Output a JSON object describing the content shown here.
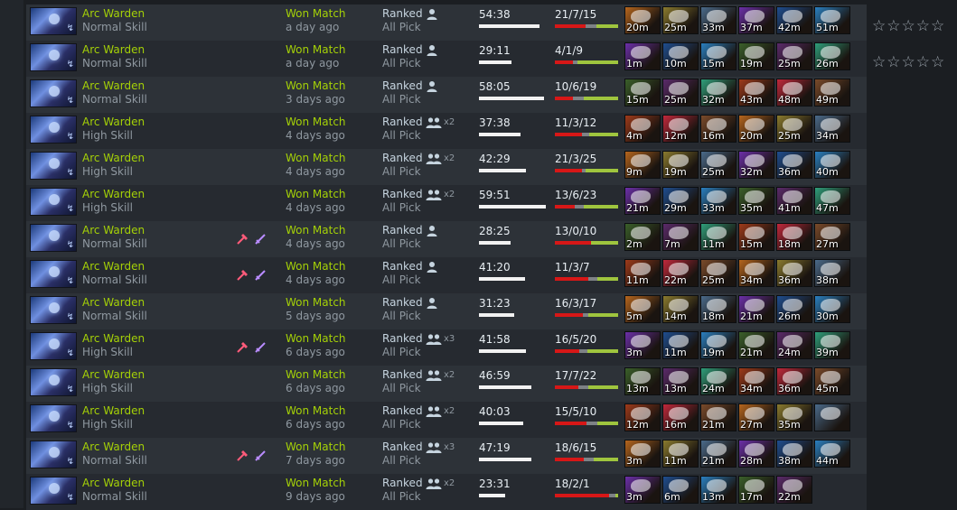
{
  "colors": {
    "win": "#a4d007",
    "muted": "#8f98a0",
    "kills": "#d71717",
    "deaths": "#7e8286",
    "assists": "#9fc53e"
  },
  "item_palette": [
    "#b5651d",
    "#2a7fbf",
    "#c0283b",
    "#6b2fa8",
    "#2f9e7a",
    "#8a7a2e",
    "#3a5f2a",
    "#7a4a2a",
    "#1e4d8f",
    "#9e3a1a",
    "#4a6a8a",
    "#5a2a6a"
  ],
  "matches": [
    {
      "hero": "Arc Warden",
      "skill": "Normal Skill",
      "party_icons": false,
      "result": "Won Match",
      "ago": "a day ago",
      "lobby": "Ranked",
      "party": "solo",
      "party_count": "",
      "mode": "All Pick",
      "duration": "54:38",
      "dur_min": 54.6,
      "kda": "21/7/15",
      "k": 21,
      "d": 7,
      "a": 15,
      "items": [
        "20m",
        "25m",
        "33m",
        "37m",
        "42m",
        "51m"
      ],
      "rating": {
        "stars": 5,
        "filled": 0
      }
    },
    {
      "hero": "Arc Warden",
      "skill": "Normal Skill",
      "party_icons": false,
      "result": "Won Match",
      "ago": "a day ago",
      "lobby": "Ranked",
      "party": "solo",
      "party_count": "",
      "mode": "All Pick",
      "duration": "29:11",
      "dur_min": 29.2,
      "kda": "4/1/9",
      "k": 4,
      "d": 1,
      "a": 9,
      "items": [
        "1m",
        "10m",
        "15m",
        "19m",
        "25m",
        "26m"
      ],
      "rating": {
        "stars": 5,
        "filled": 0
      }
    },
    {
      "hero": "Arc Warden",
      "skill": "Normal Skill",
      "party_icons": false,
      "result": "Won Match",
      "ago": "3 days ago",
      "lobby": "Ranked",
      "party": "solo",
      "party_count": "",
      "mode": "All Pick",
      "duration": "58:05",
      "dur_min": 58.1,
      "kda": "10/6/19",
      "k": 10,
      "d": 6,
      "a": 19,
      "items": [
        "15m",
        "25m",
        "32m",
        "43m",
        "48m",
        "49m"
      ]
    },
    {
      "hero": "Arc Warden",
      "skill": "High Skill",
      "party_icons": false,
      "result": "Won Match",
      "ago": "4 days ago",
      "lobby": "Ranked",
      "party": "group",
      "party_count": "x2",
      "mode": "All Pick",
      "duration": "37:38",
      "dur_min": 37.6,
      "kda": "11/3/12",
      "k": 11,
      "d": 3,
      "a": 12,
      "items": [
        "4m",
        "12m",
        "16m",
        "20m",
        "25m",
        "34m"
      ]
    },
    {
      "hero": "Arc Warden",
      "skill": "High Skill",
      "party_icons": false,
      "result": "Won Match",
      "ago": "4 days ago",
      "lobby": "Ranked",
      "party": "group",
      "party_count": "x2",
      "mode": "All Pick",
      "duration": "42:29",
      "dur_min": 42.5,
      "kda": "21/3/25",
      "k": 21,
      "d": 3,
      "a": 25,
      "items": [
        "9m",
        "19m",
        "25m",
        "32m",
        "36m",
        "40m"
      ]
    },
    {
      "hero": "Arc Warden",
      "skill": "High Skill",
      "party_icons": false,
      "result": "Won Match",
      "ago": "4 days ago",
      "lobby": "Ranked",
      "party": "group",
      "party_count": "x2",
      "mode": "All Pick",
      "duration": "59:51",
      "dur_min": 59.9,
      "kda": "13/6/23",
      "k": 13,
      "d": 6,
      "a": 23,
      "items": [
        "21m",
        "29m",
        "33m",
        "35m",
        "41m",
        "47m"
      ]
    },
    {
      "hero": "Arc Warden",
      "skill": "Normal Skill",
      "party_icons": true,
      "result": "Won Match",
      "ago": "4 days ago",
      "lobby": "Ranked",
      "party": "solo",
      "party_count": "",
      "mode": "All Pick",
      "duration": "28:25",
      "dur_min": 28.4,
      "kda": "13/0/10",
      "k": 13,
      "d": 0,
      "a": 10,
      "items": [
        "2m",
        "7m",
        "11m",
        "15m",
        "18m",
        "27m"
      ]
    },
    {
      "hero": "Arc Warden",
      "skill": "Normal Skill",
      "party_icons": true,
      "result": "Won Match",
      "ago": "4 days ago",
      "lobby": "Ranked",
      "party": "solo",
      "party_count": "",
      "mode": "All Pick",
      "duration": "41:20",
      "dur_min": 41.3,
      "kda": "11/3/7",
      "k": 11,
      "d": 3,
      "a": 7,
      "items": [
        "11m",
        "22m",
        "25m",
        "34m",
        "36m",
        "38m"
      ]
    },
    {
      "hero": "Arc Warden",
      "skill": "Normal Skill",
      "party_icons": false,
      "result": "Won Match",
      "ago": "5 days ago",
      "lobby": "Ranked",
      "party": "solo",
      "party_count": "",
      "mode": "All Pick",
      "duration": "31:23",
      "dur_min": 31.4,
      "kda": "16/3/17",
      "k": 16,
      "d": 3,
      "a": 17,
      "items": [
        "5m",
        "14m",
        "18m",
        "21m",
        "26m",
        "30m"
      ]
    },
    {
      "hero": "Arc Warden",
      "skill": "High Skill",
      "party_icons": true,
      "result": "Won Match",
      "ago": "6 days ago",
      "lobby": "Ranked",
      "party": "group",
      "party_count": "x3",
      "mode": "All Pick",
      "duration": "41:58",
      "dur_min": 42.0,
      "kda": "16/5/20",
      "k": 16,
      "d": 5,
      "a": 20,
      "items": [
        "3m",
        "11m",
        "19m",
        "21m",
        "24m",
        "39m"
      ]
    },
    {
      "hero": "Arc Warden",
      "skill": "High Skill",
      "party_icons": false,
      "result": "Won Match",
      "ago": "6 days ago",
      "lobby": "Ranked",
      "party": "group",
      "party_count": "x2",
      "mode": "All Pick",
      "duration": "46:59",
      "dur_min": 47.0,
      "kda": "17/7/22",
      "k": 17,
      "d": 7,
      "a": 22,
      "items": [
        "13m",
        "13m",
        "24m",
        "34m",
        "36m",
        "45m"
      ]
    },
    {
      "hero": "Arc Warden",
      "skill": "High Skill",
      "party_icons": false,
      "result": "Won Match",
      "ago": "6 days ago",
      "lobby": "Ranked",
      "party": "group",
      "party_count": "x2",
      "mode": "All Pick",
      "duration": "40:03",
      "dur_min": 40.1,
      "kda": "15/5/10",
      "k": 15,
      "d": 5,
      "a": 10,
      "items": [
        "12m",
        "16m",
        "21m",
        "27m",
        "35m",
        ""
      ]
    },
    {
      "hero": "Arc Warden",
      "skill": "Normal Skill",
      "party_icons": true,
      "result": "Won Match",
      "ago": "7 days ago",
      "lobby": "Ranked",
      "party": "group",
      "party_count": "x3",
      "mode": "All Pick",
      "duration": "47:19",
      "dur_min": 47.3,
      "kda": "18/6/15",
      "k": 18,
      "d": 6,
      "a": 15,
      "items": [
        "3m",
        "11m",
        "21m",
        "28m",
        "38m",
        "44m"
      ]
    },
    {
      "hero": "Arc Warden",
      "skill": "Normal Skill",
      "party_icons": false,
      "result": "Won Match",
      "ago": "9 days ago",
      "lobby": "Ranked",
      "party": "group",
      "party_count": "x2",
      "mode": "All Pick",
      "duration": "23:31",
      "dur_min": 23.5,
      "kda": "18/2/1",
      "k": 18,
      "d": 2,
      "a": 1,
      "items": [
        "3m",
        "6m",
        "13m",
        "17m",
        "22m"
      ]
    }
  ]
}
